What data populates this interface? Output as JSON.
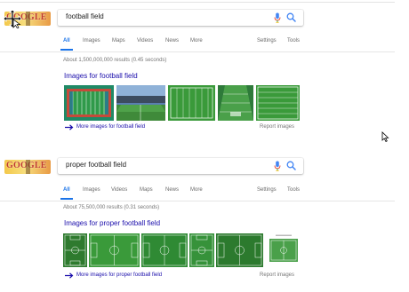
{
  "colors": {
    "accent": "#1a73e8",
    "link": "#1a0dab",
    "muted": "#777777",
    "field_green": "#3a9a3a",
    "track_red": "#c04a3a"
  },
  "logo": {
    "text": "GOOGLE"
  },
  "panels": [
    {
      "query": "football field",
      "tabs": [
        "All",
        "Images",
        "Maps",
        "Videos",
        "News",
        "More"
      ],
      "tools": [
        "Settings",
        "Tools"
      ],
      "stats": "About 1,500,000,000 results (0.45 seconds)",
      "images_heading": "Images for football field",
      "more_images": "More images for football field",
      "report": "Report images"
    },
    {
      "query": "proper football field",
      "tabs": [
        "All",
        "Images",
        "Videos",
        "Maps",
        "News",
        "More"
      ],
      "tools": [
        "Settings",
        "Tools"
      ],
      "stats": "About 75,500,000 results (0.31 seconds)",
      "images_heading": "Images for proper football field",
      "more_images": "More images for proper football field",
      "report": "Report images"
    }
  ],
  "icons": [
    "microphone-icon",
    "search-icon",
    "arrow-right-icon",
    "mouse-pointer-icon",
    "move-cursor-icon"
  ]
}
